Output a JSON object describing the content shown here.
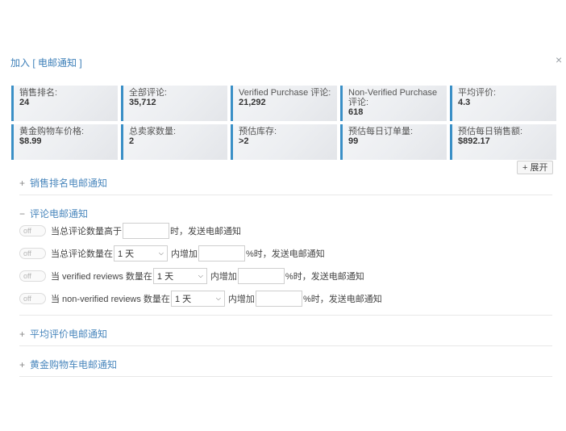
{
  "dialog": {
    "title": "加入 [ 电邮通知 ]",
    "close_label": "×"
  },
  "stats": [
    [
      {
        "label": "销售排名:",
        "value": "24"
      },
      {
        "label": "全部评论:",
        "value": "35,712"
      },
      {
        "label": "Verified Purchase 评论:",
        "value": "21,292"
      },
      {
        "label": "Non-Verified Purchase 评论:",
        "value": "618"
      },
      {
        "label": "平均评价:",
        "value": "4.3"
      }
    ],
    [
      {
        "label": "黄金购物车价格:",
        "value": "$8.99"
      },
      {
        "label": "总卖家数量:",
        "value": "2"
      },
      {
        "label": "预估库存:",
        "value": ">2"
      },
      {
        "label": "预估每日订单量:",
        "value": "99"
      },
      {
        "label": "预估每日销售额:",
        "value": "$892.17"
      }
    ]
  ],
  "expand_button": "+ 展开",
  "sections": {
    "sales_rank": {
      "sign": "+",
      "label": "销售排名电邮通知"
    },
    "review": {
      "sign": "−",
      "label": "评论电邮通知"
    },
    "avg_rating": {
      "sign": "+",
      "label": "平均评价电邮通知"
    },
    "buybox": {
      "sign": "+",
      "label": "黄金购物车电邮通知"
    }
  },
  "toggle_label": "off",
  "rules": [
    {
      "pre": "当总评论数量高于",
      "post": "时，发送电邮通知"
    },
    {
      "pre": "当总评论数量在",
      "select": "1 天",
      "mid": "内增加",
      "post": "%时，发送电邮通知"
    },
    {
      "pre": "当 verified reviews 数量在",
      "select": "1 天",
      "mid": "内增加",
      "post": "%时，发送电邮通知"
    },
    {
      "pre": "当 non-verified reviews 数量在",
      "select": "1 天",
      "mid": "内增加",
      "post": "%时，发送电邮通知"
    }
  ],
  "icons": {
    "chevron": "chevron-down-icon",
    "close": "close-icon"
  }
}
